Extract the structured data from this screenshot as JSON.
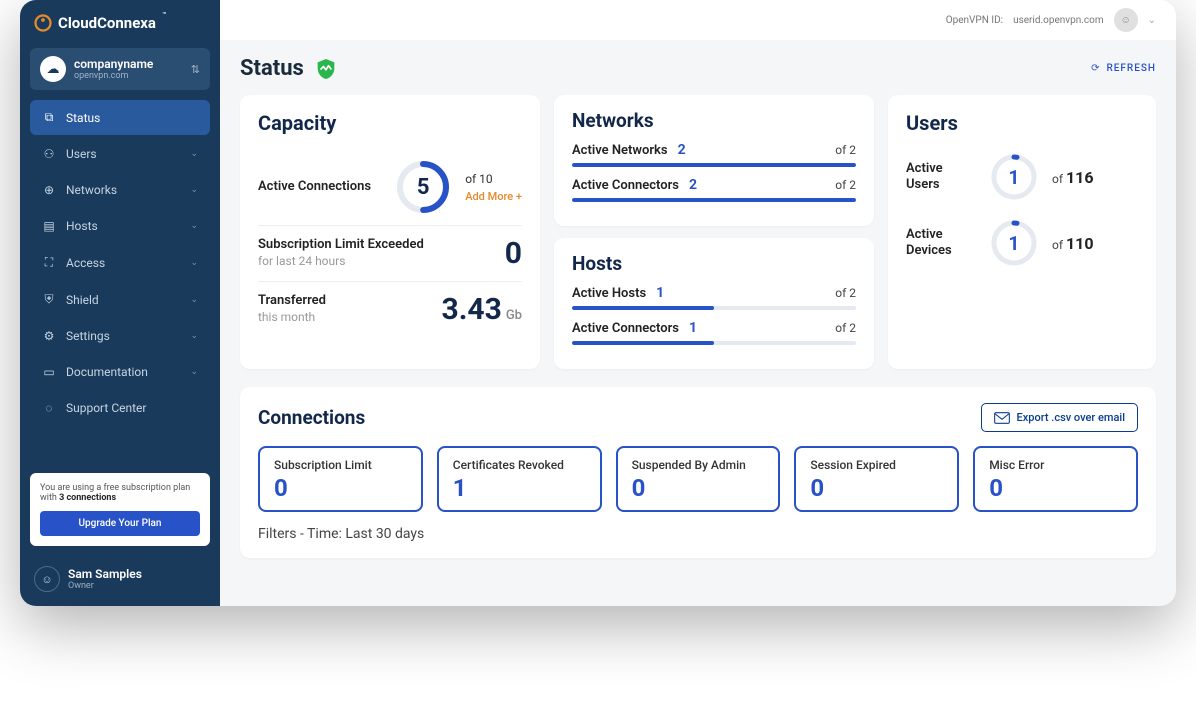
{
  "brand": {
    "name": "CloudConnexa",
    "tm": "™"
  },
  "company": {
    "name": "companyname",
    "sub": "openvpn.com"
  },
  "nav": [
    {
      "label": "Status",
      "active": true
    },
    {
      "label": "Users"
    },
    {
      "label": "Networks"
    },
    {
      "label": "Hosts"
    },
    {
      "label": "Access"
    },
    {
      "label": "Shield"
    },
    {
      "label": "Settings"
    },
    {
      "label": "Documentation"
    },
    {
      "label": "Support Center"
    }
  ],
  "promo": {
    "text_prefix": "You are using a free subscription plan with ",
    "bold": "3 connections",
    "button": "Upgrade Your Plan"
  },
  "user": {
    "name": "Sam Samples",
    "role": "Owner"
  },
  "topbar": {
    "id_label": "OpenVPN ID:",
    "id_value": "userid.openvpn.com"
  },
  "page": {
    "title": "Status",
    "refresh": "REFRESH"
  },
  "capacity": {
    "title": "Capacity",
    "active_conn_label": "Active Connections",
    "active_conn_value": "5",
    "active_conn_of": "of 10",
    "add_more": "Add More +",
    "sub_limit_label": "Subscription Limit Exceeded",
    "sub_limit_sub": "for last 24 hours",
    "sub_limit_value": "0",
    "transferred_label": "Transferred",
    "transferred_sub": "this month",
    "transferred_value": "3.43",
    "transferred_unit": "Gb"
  },
  "networks": {
    "title": "Networks",
    "active_networks_label": "Active Networks",
    "active_networks_value": "2",
    "active_networks_of": "of 2",
    "active_connectors_label": "Active Connectors",
    "active_connectors_value": "2",
    "active_connectors_of": "of 2"
  },
  "hosts": {
    "title": "Hosts",
    "active_hosts_label": "Active Hosts",
    "active_hosts_value": "1",
    "active_hosts_of": "of 2",
    "active_connectors_label": "Active Connectors",
    "active_connectors_value": "1",
    "active_connectors_of": "of 2"
  },
  "users_card": {
    "title": "Users",
    "active_users_label": "Active Users",
    "active_users_value": "1",
    "active_users_of_prefix": "of ",
    "active_users_of": "116",
    "active_devices_label": "Active Devices",
    "active_devices_value": "1",
    "active_devices_of_prefix": "of ",
    "active_devices_of": "110"
  },
  "connections": {
    "title": "Connections",
    "export": "Export .csv over email",
    "boxes": [
      {
        "label": "Subscription Limit",
        "value": "0"
      },
      {
        "label": "Certificates Revoked",
        "value": "1"
      },
      {
        "label": "Suspended By Admin",
        "value": "0"
      },
      {
        "label": "Session Expired",
        "value": "0"
      },
      {
        "label": "Misc Error",
        "value": "0"
      }
    ],
    "filters": "Filters - Time: Last 30 days"
  }
}
